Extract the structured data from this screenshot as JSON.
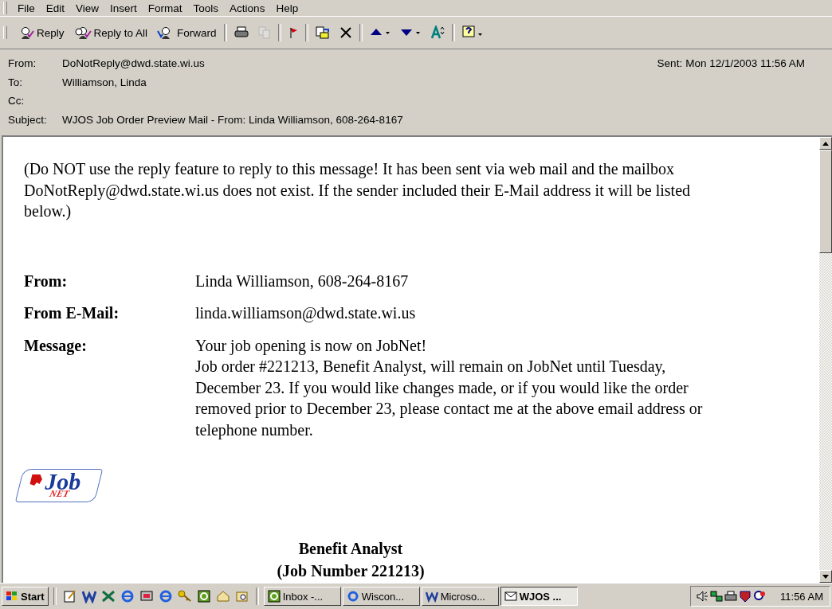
{
  "menu": [
    "File",
    "Edit",
    "View",
    "Insert",
    "Format",
    "Tools",
    "Actions",
    "Help"
  ],
  "toolbar": [
    {
      "kind": "reply",
      "label": "Reply"
    },
    {
      "kind": "replyall",
      "label": "Reply to All"
    },
    {
      "kind": "forward",
      "label": "Forward"
    },
    {
      "kind": "sep"
    },
    {
      "kind": "print"
    },
    {
      "kind": "copy",
      "disabled": true
    },
    {
      "kind": "sep"
    },
    {
      "kind": "flag"
    },
    {
      "kind": "sep"
    },
    {
      "kind": "move"
    },
    {
      "kind": "delete"
    },
    {
      "kind": "sep"
    },
    {
      "kind": "up"
    },
    {
      "kind": "down"
    },
    {
      "kind": "font"
    },
    {
      "kind": "sep"
    },
    {
      "kind": "help"
    }
  ],
  "header": {
    "fields": [
      {
        "label": "From:",
        "value": "DoNotReply@dwd.state.wi.us"
      },
      {
        "label": "To:",
        "value": "Williamson, Linda"
      },
      {
        "label": "Cc:"
      },
      {
        "label": "Subject:",
        "value": "WJOS Job Order Preview Mail - From: Linda Williamson, 608-264-8167"
      }
    ],
    "sent_label": "Sent:",
    "sent": "Mon 12/1/2003 11:56 AM"
  },
  "body": {
    "intro": "(Do NOT use the reply feature to reply to this message! It has been sent via web mail and the mailbox DoNotReply@dwd.state.wi.us does not exist. If the sender included their E-Mail address it will be listed below.)",
    "fields": [
      {
        "label": "From:",
        "paragraphs": [
          "Linda Williamson, 608-264-8167"
        ]
      },
      {
        "label": "From E-Mail:",
        "paragraphs": [
          "linda.williamson@dwd.state.wi.us"
        ]
      },
      {
        "label": "Message:",
        "paragraphs": [
          "Your job opening is now on JobNet!",
          "Job order #221213, Benefit Analyst, will remain on JobNet until Tuesday, December 23. If you would like changes made, or if you would like the order removed prior to December 23, please contact me at the above email address or telephone number."
        ]
      }
    ],
    "logo": {
      "text": "Job",
      "subtext": "NET"
    },
    "title": "Benefit Analyst",
    "subtitle": "(Job Number 221213)"
  },
  "taskbar": {
    "start": "Start",
    "tasks": [
      {
        "label": "Inbox -...",
        "selected": false
      },
      {
        "label": "Wiscon...",
        "selected": false
      },
      {
        "label": "Microso...",
        "selected": false
      },
      {
        "label": "WJOS ...",
        "selected": true
      }
    ],
    "clock": "11:56 AM"
  }
}
